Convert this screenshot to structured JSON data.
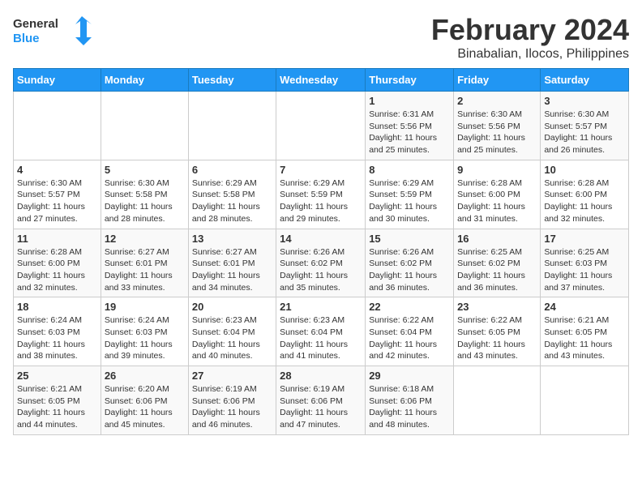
{
  "logo": {
    "line1": "General",
    "line2": "Blue"
  },
  "title": "February 2024",
  "subtitle": "Binabalian, Ilocos, Philippines",
  "headers": [
    "Sunday",
    "Monday",
    "Tuesday",
    "Wednesday",
    "Thursday",
    "Friday",
    "Saturday"
  ],
  "weeks": [
    [
      {
        "day": "",
        "info": ""
      },
      {
        "day": "",
        "info": ""
      },
      {
        "day": "",
        "info": ""
      },
      {
        "day": "",
        "info": ""
      },
      {
        "day": "1",
        "info": "Sunrise: 6:31 AM\nSunset: 5:56 PM\nDaylight: 11 hours and 25 minutes."
      },
      {
        "day": "2",
        "info": "Sunrise: 6:30 AM\nSunset: 5:56 PM\nDaylight: 11 hours and 25 minutes."
      },
      {
        "day": "3",
        "info": "Sunrise: 6:30 AM\nSunset: 5:57 PM\nDaylight: 11 hours and 26 minutes."
      }
    ],
    [
      {
        "day": "4",
        "info": "Sunrise: 6:30 AM\nSunset: 5:57 PM\nDaylight: 11 hours and 27 minutes."
      },
      {
        "day": "5",
        "info": "Sunrise: 6:30 AM\nSunset: 5:58 PM\nDaylight: 11 hours and 28 minutes."
      },
      {
        "day": "6",
        "info": "Sunrise: 6:29 AM\nSunset: 5:58 PM\nDaylight: 11 hours and 28 minutes."
      },
      {
        "day": "7",
        "info": "Sunrise: 6:29 AM\nSunset: 5:59 PM\nDaylight: 11 hours and 29 minutes."
      },
      {
        "day": "8",
        "info": "Sunrise: 6:29 AM\nSunset: 5:59 PM\nDaylight: 11 hours and 30 minutes."
      },
      {
        "day": "9",
        "info": "Sunrise: 6:28 AM\nSunset: 6:00 PM\nDaylight: 11 hours and 31 minutes."
      },
      {
        "day": "10",
        "info": "Sunrise: 6:28 AM\nSunset: 6:00 PM\nDaylight: 11 hours and 32 minutes."
      }
    ],
    [
      {
        "day": "11",
        "info": "Sunrise: 6:28 AM\nSunset: 6:00 PM\nDaylight: 11 hours and 32 minutes."
      },
      {
        "day": "12",
        "info": "Sunrise: 6:27 AM\nSunset: 6:01 PM\nDaylight: 11 hours and 33 minutes."
      },
      {
        "day": "13",
        "info": "Sunrise: 6:27 AM\nSunset: 6:01 PM\nDaylight: 11 hours and 34 minutes."
      },
      {
        "day": "14",
        "info": "Sunrise: 6:26 AM\nSunset: 6:02 PM\nDaylight: 11 hours and 35 minutes."
      },
      {
        "day": "15",
        "info": "Sunrise: 6:26 AM\nSunset: 6:02 PM\nDaylight: 11 hours and 36 minutes."
      },
      {
        "day": "16",
        "info": "Sunrise: 6:25 AM\nSunset: 6:02 PM\nDaylight: 11 hours and 36 minutes."
      },
      {
        "day": "17",
        "info": "Sunrise: 6:25 AM\nSunset: 6:03 PM\nDaylight: 11 hours and 37 minutes."
      }
    ],
    [
      {
        "day": "18",
        "info": "Sunrise: 6:24 AM\nSunset: 6:03 PM\nDaylight: 11 hours and 38 minutes."
      },
      {
        "day": "19",
        "info": "Sunrise: 6:24 AM\nSunset: 6:03 PM\nDaylight: 11 hours and 39 minutes."
      },
      {
        "day": "20",
        "info": "Sunrise: 6:23 AM\nSunset: 6:04 PM\nDaylight: 11 hours and 40 minutes."
      },
      {
        "day": "21",
        "info": "Sunrise: 6:23 AM\nSunset: 6:04 PM\nDaylight: 11 hours and 41 minutes."
      },
      {
        "day": "22",
        "info": "Sunrise: 6:22 AM\nSunset: 6:04 PM\nDaylight: 11 hours and 42 minutes."
      },
      {
        "day": "23",
        "info": "Sunrise: 6:22 AM\nSunset: 6:05 PM\nDaylight: 11 hours and 43 minutes."
      },
      {
        "day": "24",
        "info": "Sunrise: 6:21 AM\nSunset: 6:05 PM\nDaylight: 11 hours and 43 minutes."
      }
    ],
    [
      {
        "day": "25",
        "info": "Sunrise: 6:21 AM\nSunset: 6:05 PM\nDaylight: 11 hours and 44 minutes."
      },
      {
        "day": "26",
        "info": "Sunrise: 6:20 AM\nSunset: 6:06 PM\nDaylight: 11 hours and 45 minutes."
      },
      {
        "day": "27",
        "info": "Sunrise: 6:19 AM\nSunset: 6:06 PM\nDaylight: 11 hours and 46 minutes."
      },
      {
        "day": "28",
        "info": "Sunrise: 6:19 AM\nSunset: 6:06 PM\nDaylight: 11 hours and 47 minutes."
      },
      {
        "day": "29",
        "info": "Sunrise: 6:18 AM\nSunset: 6:06 PM\nDaylight: 11 hours and 48 minutes."
      },
      {
        "day": "",
        "info": ""
      },
      {
        "day": "",
        "info": ""
      }
    ]
  ]
}
